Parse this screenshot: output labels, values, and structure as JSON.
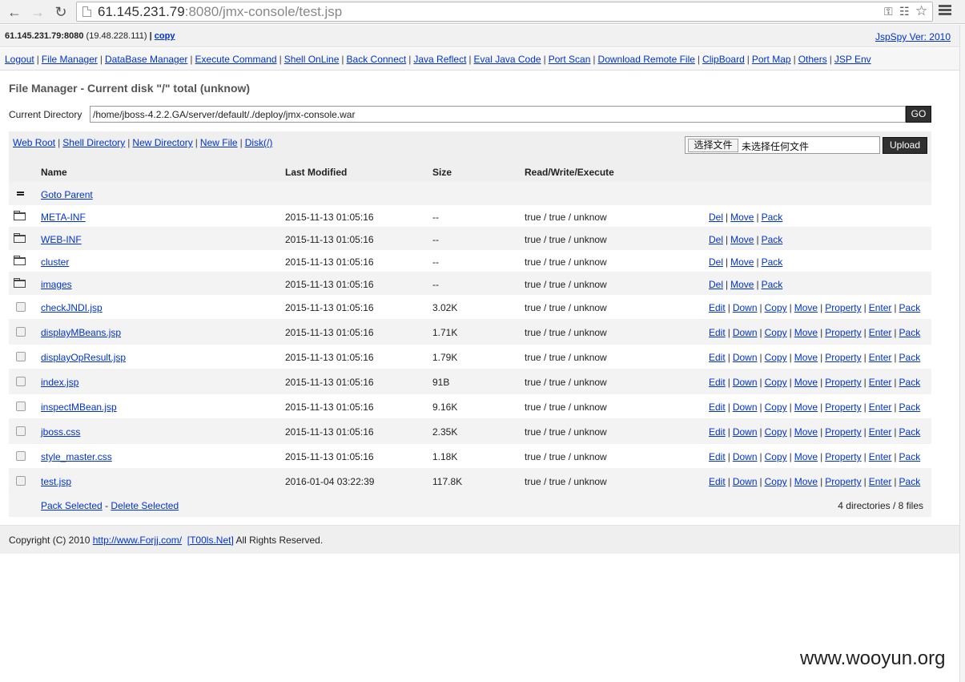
{
  "browser": {
    "url_host": "61.145.231.79",
    "url_rest": ":8080/jmx-console/test.jsp",
    "back_icon": "back-arrow-icon",
    "forward_icon": "forward-arrow-icon",
    "reload_icon": "reload-icon"
  },
  "topbar": {
    "host": "61.145.231.79:8080",
    "client_ip": "(19.48.228.111)",
    "sep": "|",
    "copy_label": "copy",
    "version": "JspSpy Ver: 2010"
  },
  "menu": [
    "Logout",
    "File Manager",
    "DataBase Manager",
    "Execute Command",
    "Shell OnLine",
    "Back Connect",
    "Java Reflect",
    "Eval Java Code",
    "Port Scan",
    "Download Remote File",
    "ClipBoard",
    "Port Map",
    "Others",
    "JSP Env"
  ],
  "file_manager": {
    "title": "File Manager - Current disk \"/\" total (unknow)",
    "current_dir_label": "Current Directory",
    "current_dir_value": "/home/jboss-4.2.2.GA/server/default/./deploy/jmx-console.war",
    "go_label": "GO",
    "tools": [
      "Web Root",
      "Shell Directory",
      "New Directory",
      "New File",
      "Disk(/)"
    ],
    "choose_file_label": "选择文件",
    "no_file_label": "未选择任何文件",
    "upload_label": "Upload"
  },
  "table": {
    "headers": {
      "name": "Name",
      "modified": "Last Modified",
      "size": "Size",
      "rwx": "Read/Write/Execute"
    },
    "goto_parent": "Goto Parent",
    "dirs": [
      {
        "name": "META-INF",
        "modified": "2015-11-13 01:05:16",
        "size": "--",
        "rwx": "true / true / unknow"
      },
      {
        "name": "WEB-INF",
        "modified": "2015-11-13 01:05:16",
        "size": "--",
        "rwx": "true / true / unknow"
      },
      {
        "name": "cluster",
        "modified": "2015-11-13 01:05:16",
        "size": "--",
        "rwx": "true / true / unknow"
      },
      {
        "name": "images",
        "modified": "2015-11-13 01:05:16",
        "size": "--",
        "rwx": "true / true / unknow"
      }
    ],
    "dir_actions": [
      "Del",
      "Move",
      "Pack"
    ],
    "files": [
      {
        "name": "checkJNDI.jsp",
        "modified": "2015-11-13 01:05:16",
        "size": "3.02K",
        "rwx": "true / true / unknow"
      },
      {
        "name": "displayMBeans.jsp",
        "modified": "2015-11-13 01:05:16",
        "size": "1.71K",
        "rwx": "true / true / unknow"
      },
      {
        "name": "displayOpResult.jsp",
        "modified": "2015-11-13 01:05:16",
        "size": "1.79K",
        "rwx": "true / true / unknow"
      },
      {
        "name": "index.jsp",
        "modified": "2015-11-13 01:05:16",
        "size": "91B",
        "rwx": "true / true / unknow"
      },
      {
        "name": "inspectMBean.jsp",
        "modified": "2015-11-13 01:05:16",
        "size": "9.16K",
        "rwx": "true / true / unknow"
      },
      {
        "name": "jboss.css",
        "modified": "2015-11-13 01:05:16",
        "size": "2.35K",
        "rwx": "true / true / unknow"
      },
      {
        "name": "style_master.css",
        "modified": "2015-11-13 01:05:16",
        "size": "1.18K",
        "rwx": "true / true / unknow"
      },
      {
        "name": "test.jsp",
        "modified": "2016-01-04 03:22:39",
        "size": "117.8K",
        "rwx": "true / true / unknow"
      }
    ],
    "file_actions": [
      "Edit",
      "Down",
      "Copy",
      "Move",
      "Property",
      "Enter",
      "Pack"
    ],
    "pack_selected": "Pack Selected",
    "dash": "-",
    "delete_selected": "Delete Selected",
    "summary": "4 directories / 8 files"
  },
  "footer": {
    "prefix": "Copyright (C) 2010",
    "link1": "http://www.Forjj.com/",
    "link2": "[T00ls.Net]",
    "suffix": "All Rights Reserved."
  },
  "watermark": "www.wooyun.org"
}
